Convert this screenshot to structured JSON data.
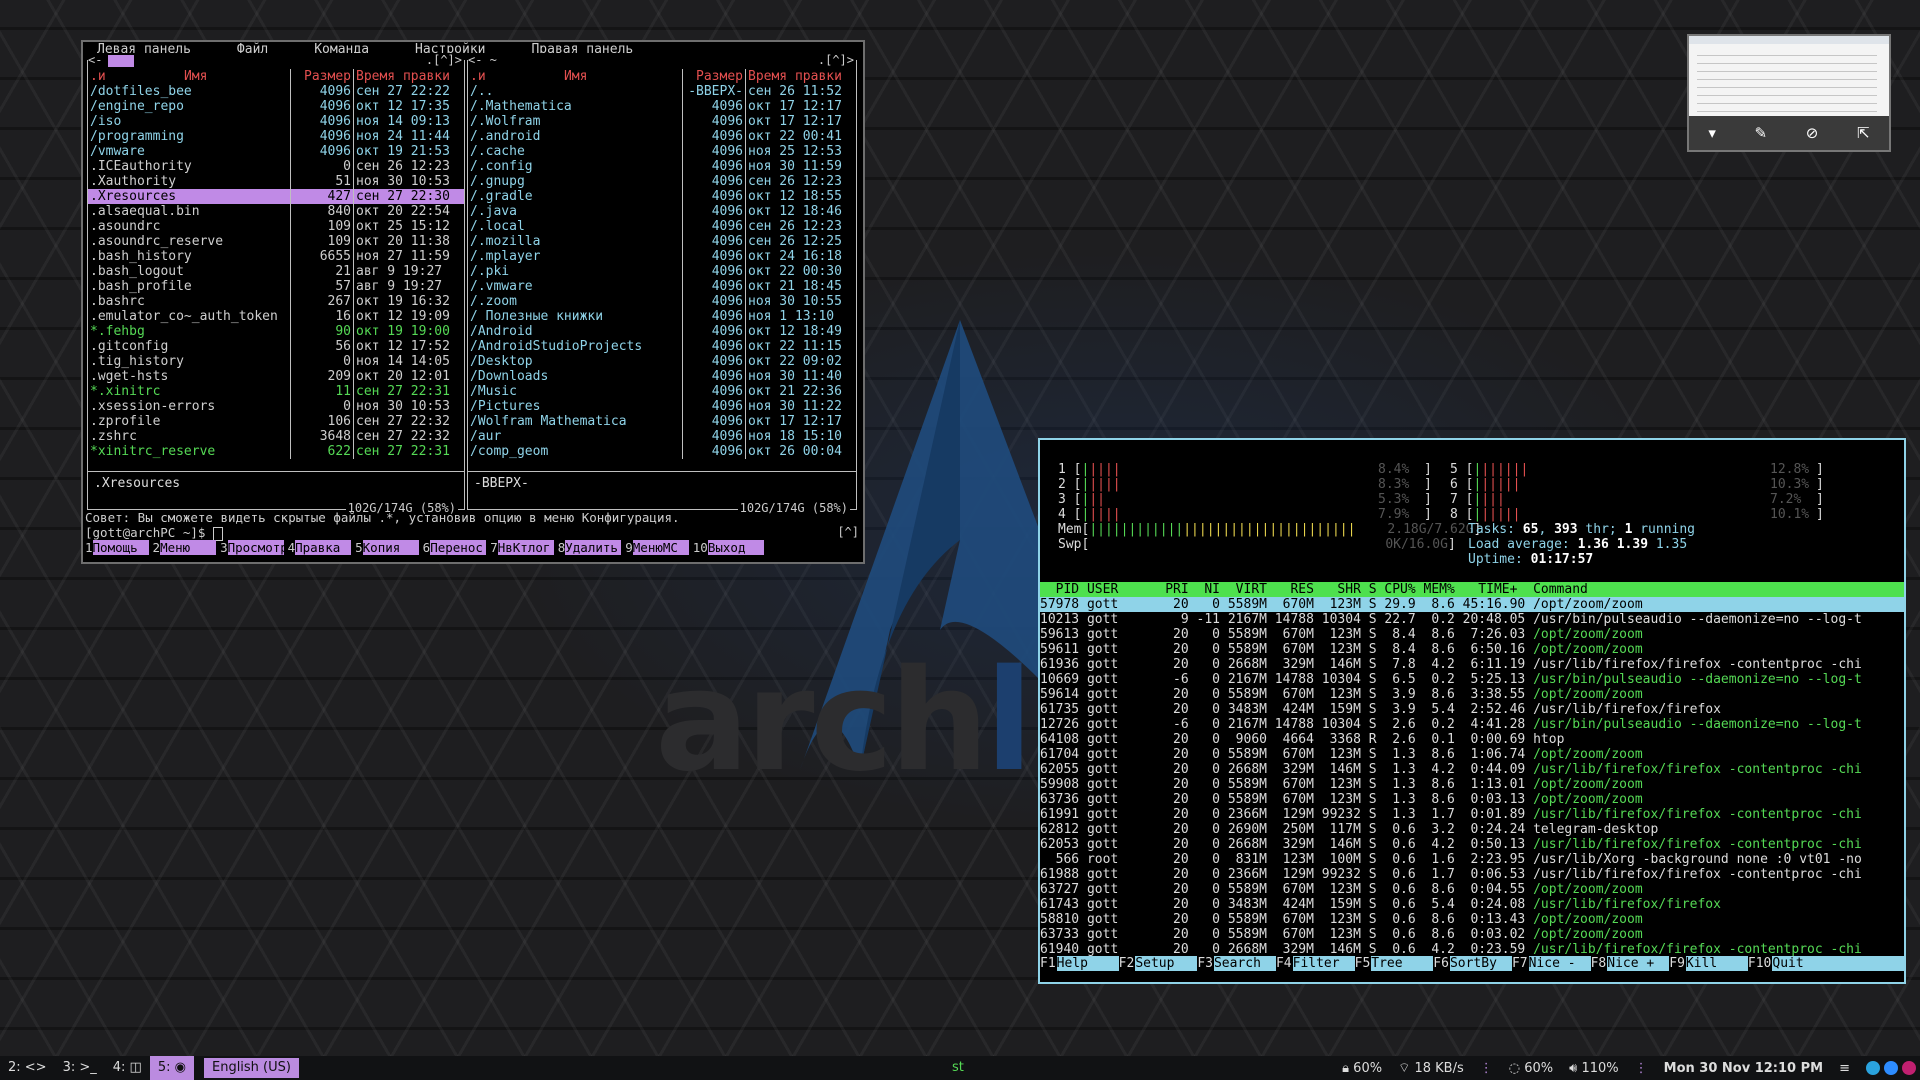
{
  "mc": {
    "menu": [
      "Левая панель",
      "Файл",
      "Команда",
      "Настройки",
      "Правая панель"
    ],
    "left": {
      "top_right": ".[^]>",
      "headers": {
        "sort": ".и",
        "name": "Имя",
        "size": "Размер",
        "time": "Время правки"
      },
      "rows": [
        {
          "name": "/dotfiles_bee",
          "size": "4096",
          "time": "сен 27 22:22",
          "type": "dir"
        },
        {
          "name": "/engine_repo",
          "size": "4096",
          "time": "окт 12 17:35",
          "type": "dir"
        },
        {
          "name": "/iso",
          "size": "4096",
          "time": "ноя 14 09:13",
          "type": "dir"
        },
        {
          "name": "/programming",
          "size": "4096",
          "time": "ноя 24 11:44",
          "type": "dir"
        },
        {
          "name": "/vmware",
          "size": "4096",
          "time": "окт 19 21:53",
          "type": "dir"
        },
        {
          "name": " .ICEauthority",
          "size": "0",
          "time": "сен 26 12:23",
          "type": "file"
        },
        {
          "name": " .Xauthority",
          "size": "51",
          "time": "ноя 30 10:53",
          "type": "file"
        },
        {
          "name": " .Xresources",
          "size": "427",
          "time": "сен 27 22:30",
          "type": "sel"
        },
        {
          "name": " .alsaequal.bin",
          "size": "840",
          "time": "окт 20 22:54",
          "type": "file"
        },
        {
          "name": " .asoundrc",
          "size": "109",
          "time": "окт 25 15:12",
          "type": "file"
        },
        {
          "name": " .asoundrc_reserve",
          "size": "109",
          "time": "окт 20 11:38",
          "type": "file"
        },
        {
          "name": " .bash_history",
          "size": "6655",
          "time": "ноя 27 11:59",
          "type": "file"
        },
        {
          "name": " .bash_logout",
          "size": "21",
          "time": "авг  9 19:27",
          "type": "file"
        },
        {
          "name": " .bash_profile",
          "size": "57",
          "time": "авг  9 19:27",
          "type": "file"
        },
        {
          "name": " .bashrc",
          "size": "267",
          "time": "окт 19 16:32",
          "type": "file"
        },
        {
          "name": " .emulator_co~_auth_token",
          "size": "16",
          "time": "окт 12 19:09",
          "type": "file"
        },
        {
          "name": "*.fehbg",
          "size": "90",
          "time": "окт 19 19:00",
          "type": "exec"
        },
        {
          "name": " .gitconfig",
          "size": "56",
          "time": "окт 12 17:52",
          "type": "file"
        },
        {
          "name": " .tig_history",
          "size": "0",
          "time": "ноя 14 14:05",
          "type": "file"
        },
        {
          "name": " .wget-hsts",
          "size": "209",
          "time": "окт 20 12:01",
          "type": "file"
        },
        {
          "name": "*.xinitrc",
          "size": "11",
          "time": "сен 27 22:31",
          "type": "exec"
        },
        {
          "name": " .xsession-errors",
          "size": "0",
          "time": "ноя 30 10:53",
          "type": "file"
        },
        {
          "name": " .zprofile",
          "size": "106",
          "time": "сен 27 22:32",
          "type": "file"
        },
        {
          "name": " .zshrc",
          "size": "3648",
          "time": "сен 27 22:32",
          "type": "file"
        },
        {
          "name": "*xinitrc_reserve",
          "size": "622",
          "time": "сен 27 22:31",
          "type": "exec"
        }
      ],
      "footer": ".Xresources",
      "status": "102G/174G (58%)"
    },
    "right": {
      "top_left": "<- ~",
      "top_right": ".[^]>",
      "headers": {
        "sort": ".и",
        "name": "Имя",
        "size": "Размер",
        "time": "Время правки"
      },
      "rows": [
        {
          "name": "/..",
          "size": "-ВВЕРХ-",
          "time": "сен 26 11:52",
          "type": "dir"
        },
        {
          "name": "/.Mathematica",
          "size": "4096",
          "time": "окт 17 12:17",
          "type": "dir"
        },
        {
          "name": "/.Wolfram",
          "size": "4096",
          "time": "окт 17 12:17",
          "type": "dir"
        },
        {
          "name": "/.android",
          "size": "4096",
          "time": "окт 22 00:41",
          "type": "dir"
        },
        {
          "name": "/.cache",
          "size": "4096",
          "time": "ноя 25 12:53",
          "type": "dir"
        },
        {
          "name": "/.config",
          "size": "4096",
          "time": "ноя 30 11:59",
          "type": "dir"
        },
        {
          "name": "/.gnupg",
          "size": "4096",
          "time": "сен 26 12:23",
          "type": "dir"
        },
        {
          "name": "/.gradle",
          "size": "4096",
          "time": "окт 12 18:55",
          "type": "dir"
        },
        {
          "name": "/.java",
          "size": "4096",
          "time": "окт 12 18:46",
          "type": "dir"
        },
        {
          "name": "/.local",
          "size": "4096",
          "time": "сен 26 12:23",
          "type": "dir"
        },
        {
          "name": "/.mozilla",
          "size": "4096",
          "time": "сен 26 12:25",
          "type": "dir"
        },
        {
          "name": "/.mplayer",
          "size": "4096",
          "time": "окт 24 16:18",
          "type": "dir"
        },
        {
          "name": "/.pki",
          "size": "4096",
          "time": "окт 22 00:30",
          "type": "dir"
        },
        {
          "name": "/.vmware",
          "size": "4096",
          "time": "окт 21 18:45",
          "type": "dir"
        },
        {
          "name": "/.zoom",
          "size": "4096",
          "time": "ноя 30 10:55",
          "type": "dir"
        },
        {
          "name": "/ Полезные книжки",
          "size": "4096",
          "time": "ноя  1 13:10",
          "type": "dir"
        },
        {
          "name": "/Android",
          "size": "4096",
          "time": "окт 12 18:49",
          "type": "dir"
        },
        {
          "name": "/AndroidStudioProjects",
          "size": "4096",
          "time": "окт 22 11:15",
          "type": "dir"
        },
        {
          "name": "/Desktop",
          "size": "4096",
          "time": "окт 22 09:02",
          "type": "dir"
        },
        {
          "name": "/Downloads",
          "size": "4096",
          "time": "ноя 30 11:40",
          "type": "dir"
        },
        {
          "name": "/Music",
          "size": "4096",
          "time": "окт 21 22:36",
          "type": "dir"
        },
        {
          "name": "/Pictures",
          "size": "4096",
          "time": "ноя 30 11:22",
          "type": "dir"
        },
        {
          "name": "/Wolfram Mathematica",
          "size": "4096",
          "time": "окт 17 12:17",
          "type": "dir"
        },
        {
          "name": "/aur",
          "size": "4096",
          "time": "ноя 18 15:10",
          "type": "dir"
        },
        {
          "name": "/comp_geom",
          "size": "4096",
          "time": "окт 26 00:04",
          "type": "dir"
        }
      ],
      "footer": "-ВВЕРХ-",
      "status": "102G/174G (58%)"
    },
    "hint": "Совет: Вы сможете видеть скрытые файлы .*, установив опцию в меню Конфигурация.",
    "prompt": "[gott@archPC ~]$ ",
    "prompt_right": "[^]",
    "fkeys": [
      {
        "n": "1",
        "label": "Помощь"
      },
      {
        "n": "2",
        "label": "Меню"
      },
      {
        "n": "3",
        "label": "Просмотр"
      },
      {
        "n": "4",
        "label": "Правка"
      },
      {
        "n": "5",
        "label": "Копия"
      },
      {
        "n": "6",
        "label": "Перенос"
      },
      {
        "n": "7",
        "label": "НвКтлог"
      },
      {
        "n": "8",
        "label": "Удалить"
      },
      {
        "n": "9",
        "label": "МенюMC"
      },
      {
        "n": "10",
        "label": "Выход"
      }
    ]
  },
  "htop": {
    "cpus": [
      {
        "n": "1",
        "pct": "8.4%"
      },
      {
        "n": "2",
        "pct": "8.3%"
      },
      {
        "n": "3",
        "pct": "5.3%"
      },
      {
        "n": "4",
        "pct": "7.9%"
      },
      {
        "n": "5",
        "pct": "12.8%"
      },
      {
        "n": "6",
        "pct": "10.3%"
      },
      {
        "n": "7",
        "pct": "7.2%"
      },
      {
        "n": "8",
        "pct": "10.1%"
      }
    ],
    "mem": {
      "label": "Mem",
      "value": "2.18G/7.62G"
    },
    "swp": {
      "label": "Swp",
      "value": "0K/16.0G"
    },
    "tasks": {
      "label": "Tasks: ",
      "tasks": "65",
      "thr": "393",
      "thr_label": " thr; ",
      "running": "1",
      "running_label": " running"
    },
    "load": {
      "label": "Load average: ",
      "a": "1.36",
      "b": "1.39",
      "c": "1.35"
    },
    "uptime": {
      "label": "Uptime: ",
      "value": "01:17:57"
    },
    "header": "  PID USER      PRI  NI  VIRT   RES   SHR S CPU% MEM%   TIME+  Command",
    "processes": [
      {
        "line": "57978 gott       20   0 5589M  670M  123M S 29.9  8.6 45:16.90 ",
        "cmd": "/opt/zoom/zoom",
        "green": false,
        "sel": true
      },
      {
        "line": "10213 gott        9 -11 2167M 14788 10304 S 22.7  0.2 20:48.05 ",
        "cmd": "/usr/bin/pulseaudio --daemonize=no --log-t",
        "green": false
      },
      {
        "line": "59613 gott       20   0 5589M  670M  123M S  8.4  8.6  7:26.03 ",
        "cmd": "/opt/zoom/zoom",
        "green": true
      },
      {
        "line": "59611 gott       20   0 5589M  670M  123M S  8.4  8.6  6:50.16 ",
        "cmd": "/opt/zoom/zoom",
        "green": true
      },
      {
        "line": "61936 gott       20   0 2668M  329M  146M S  7.8  4.2  6:11.19 ",
        "cmd": "/usr/lib/firefox/firefox -contentproc -chi",
        "green": false
      },
      {
        "line": "10669 gott       -6   0 2167M 14788 10304 S  6.5  0.2  5:25.13 ",
        "cmd": "/usr/bin/pulseaudio --daemonize=no --log-t",
        "green": true
      },
      {
        "line": "59614 gott       20   0 5589M  670M  123M S  3.9  8.6  3:38.55 ",
        "cmd": "/opt/zoom/zoom",
        "green": true
      },
      {
        "line": "61735 gott       20   0 3483M  424M  159M S  3.9  5.4  2:52.46 ",
        "cmd": "/usr/lib/firefox/firefox",
        "green": false
      },
      {
        "line": "12726 gott       -6   0 2167M 14788 10304 S  2.6  0.2  4:41.28 ",
        "cmd": "/usr/bin/pulseaudio --daemonize=no --log-t",
        "green": true
      },
      {
        "line": "64108 gott       20   0  9060  4664  3368 R  2.6  0.1  0:00.69 ",
        "cmd": "htop",
        "green": false
      },
      {
        "line": "61704 gott       20   0 5589M  670M  123M S  1.3  8.6  1:06.74 ",
        "cmd": "/opt/zoom/zoom",
        "green": true
      },
      {
        "line": "62055 gott       20   0 2668M  329M  146M S  1.3  4.2  0:44.09 ",
        "cmd": "/usr/lib/firefox/firefox -contentproc -chi",
        "green": true
      },
      {
        "line": "59908 gott       20   0 5589M  670M  123M S  1.3  8.6  1:13.01 ",
        "cmd": "/opt/zoom/zoom",
        "green": true
      },
      {
        "line": "63736 gott       20   0 5589M  670M  123M S  1.3  8.6  0:03.13 ",
        "cmd": "/opt/zoom/zoom",
        "green": true
      },
      {
        "line": "61991 gott       20   0 2366M  129M 99232 S  1.3  1.7  0:01.89 ",
        "cmd": "/usr/lib/firefox/firefox -contentproc -chi",
        "green": true
      },
      {
        "line": "62812 gott       20   0 2690M  250M  117M S  0.6  3.2  0:24.24 ",
        "cmd": "telegram-desktop",
        "green": false
      },
      {
        "line": "62053 gott       20   0 2668M  329M  146M S  0.6  4.2  0:50.13 ",
        "cmd": "/usr/lib/firefox/firefox -contentproc -chi",
        "green": true
      },
      {
        "line": "  566 root       20   0  831M  123M  100M S  0.6  1.6  2:23.95 ",
        "cmd": "/usr/lib/Xorg -background none :0 vt01 -no",
        "green": false
      },
      {
        "line": "61988 gott       20   0 2366M  129M 99232 S  0.6  1.7  0:06.53 ",
        "cmd": "/usr/lib/firefox/firefox -contentproc -chi",
        "green": false
      },
      {
        "line": "63727 gott       20   0 5589M  670M  123M S  0.6  8.6  0:04.55 ",
        "cmd": "/opt/zoom/zoom",
        "green": true
      },
      {
        "line": "61743 gott       20   0 3483M  424M  159M S  0.6  5.4  0:24.08 ",
        "cmd": "/usr/lib/firefox/firefox",
        "green": true
      },
      {
        "line": "58810 gott       20   0 5589M  670M  123M S  0.6  8.6  0:13.43 ",
        "cmd": "/opt/zoom/zoom",
        "green": true
      },
      {
        "line": "63733 gott       20   0 5589M  670M  123M S  0.6  8.6  0:03.02 ",
        "cmd": "/opt/zoom/zoom",
        "green": true
      },
      {
        "line": "61940 gott       20   0 2668M  329M  146M S  0.6  4.2  0:23.59 ",
        "cmd": "/usr/lib/firefox/firefox -contentproc -chi",
        "green": true
      }
    ],
    "fkeys": [
      {
        "n": "F1",
        "label": "Help"
      },
      {
        "n": "F2",
        "label": "Setup"
      },
      {
        "n": "F3",
        "label": "Search"
      },
      {
        "n": "F4",
        "label": "Filter"
      },
      {
        "n": "F5",
        "label": "Tree"
      },
      {
        "n": "F6",
        "label": "SortBy"
      },
      {
        "n": "F7",
        "label": "Nice -"
      },
      {
        "n": "F8",
        "label": "Nice +"
      },
      {
        "n": "F9",
        "label": "Kill"
      },
      {
        "n": "F10",
        "label": "Quit"
      }
    ]
  },
  "desktop": {
    "logo_text_a": "arch",
    "logo_text_b": "lin"
  },
  "taskbar": {
    "tags": [
      {
        "label": "2: <>",
        "active": false
      },
      {
        "label": "3: >_",
        "active": false
      },
      {
        "label": "4: ◫",
        "active": false
      },
      {
        "label": "5: ◉",
        "active": true
      }
    ],
    "layout": "English (US)",
    "title": "st",
    "battery": "60%",
    "net": "18 KB/s",
    "brightness": "60%",
    "volume": "110%",
    "clock": "Mon 30 Nov 12:10 PM"
  },
  "colors": {
    "accent": "#bb8be0",
    "cyan": "#8fd3e8",
    "green": "#55d955",
    "red": "#e45050"
  }
}
